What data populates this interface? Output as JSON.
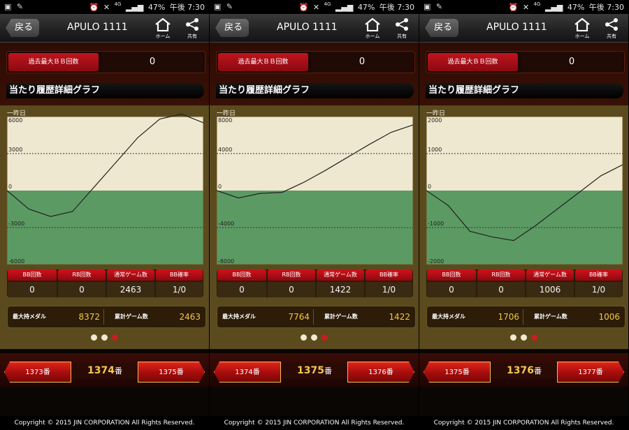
{
  "status": {
    "battery": "47%",
    "time": "午後 7:30",
    "network": "4G"
  },
  "common": {
    "back_label": "戻る",
    "app_title": "APULO 1111",
    "home_label": "ホーム",
    "share_label": "共有",
    "max_bb_label": "過去最大ＢＢ回数",
    "section_title": "当たり履歴詳細グラフ",
    "day_label": "一昨日",
    "stat_headers": [
      "BB回数",
      "RB回数",
      "通常ゲーム数",
      "BB確率"
    ],
    "max_medal_label": "最大持メダル",
    "total_games_label": "累計ゲーム数",
    "num_suffix": "番",
    "footer": "Copyright © 2015 JIN CORPORATION All Rights Reserved.",
    "colors": {
      "positive_bg": "#efe8d0",
      "negative_bg": "#5c9a64",
      "line": "#222222",
      "dot_active": "#c81e1e",
      "dot_inactive": "#f0ead0"
    }
  },
  "panels": [
    {
      "max_bb": "0",
      "yticks": [
        "6000",
        "3000",
        "0",
        "-3000",
        "-6000"
      ],
      "ymax": 6000,
      "chart_data": {
        "type": "line",
        "x": [
          0,
          1,
          2,
          3,
          4,
          5,
          6,
          7,
          8,
          9
        ],
        "values": [
          0,
          -1500,
          -2100,
          -1700,
          300,
          2300,
          4300,
          5800,
          6200,
          5500
        ],
        "ylim": [
          -6000,
          6000
        ],
        "ylabel": "",
        "xlabel": "",
        "title": ""
      },
      "stats": [
        "0",
        "0",
        "2463",
        "1/0"
      ],
      "max_medal": "8372",
      "total_games": "2463",
      "active_dot": 2,
      "prev_num": "1373番",
      "cur_num": "1374",
      "next_num": "1375番"
    },
    {
      "max_bb": "0",
      "yticks": [
        "8000",
        "4000",
        "0",
        "-4000",
        "-8000"
      ],
      "ymax": 8000,
      "chart_data": {
        "type": "line",
        "x": [
          0,
          1,
          2,
          3,
          4,
          5,
          6,
          7,
          8,
          9
        ],
        "values": [
          0,
          -800,
          -300,
          -200,
          900,
          2200,
          3600,
          5000,
          6300,
          7100
        ],
        "ylim": [
          -8000,
          8000
        ],
        "ylabel": "",
        "xlabel": "",
        "title": ""
      },
      "stats": [
        "0",
        "0",
        "1422",
        "1/0"
      ],
      "max_medal": "7764",
      "total_games": "1422",
      "active_dot": 2,
      "prev_num": "1374番",
      "cur_num": "1375",
      "next_num": "1376番"
    },
    {
      "max_bb": "0",
      "yticks": [
        "2000",
        "1000",
        "0",
        "-1000",
        "-2000"
      ],
      "ymax": 2000,
      "chart_data": {
        "type": "line",
        "x": [
          0,
          1,
          2,
          3,
          4,
          5,
          6,
          7,
          8,
          9
        ],
        "values": [
          0,
          -400,
          -1100,
          -1250,
          -1350,
          -950,
          -500,
          -50,
          400,
          700
        ],
        "ylim": [
          -2000,
          2000
        ],
        "ylabel": "",
        "xlabel": "",
        "title": ""
      },
      "stats": [
        "0",
        "0",
        "1006",
        "1/0"
      ],
      "max_medal": "1706",
      "total_games": "1006",
      "active_dot": 2,
      "prev_num": "1375番",
      "cur_num": "1376",
      "next_num": "1377番"
    }
  ]
}
